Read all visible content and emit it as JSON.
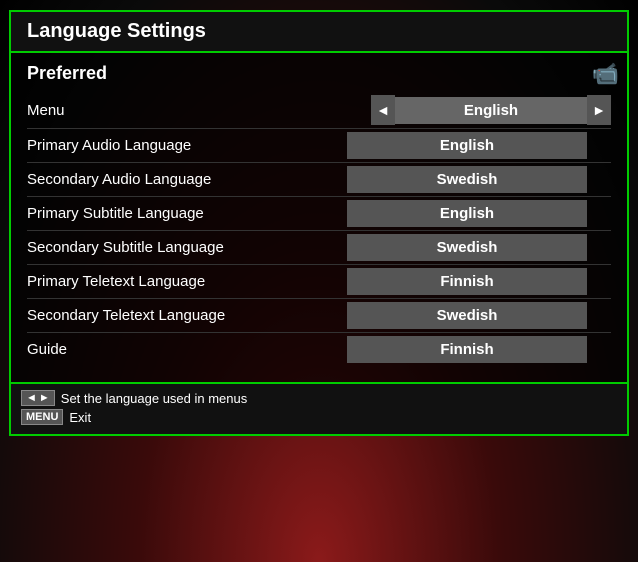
{
  "title": "Language Settings",
  "preferred_label": "Preferred",
  "rows": [
    {
      "id": "menu",
      "label": "Menu",
      "value": "English",
      "has_arrows": true
    },
    {
      "id": "primary-audio",
      "label": "Primary Audio Language",
      "value": "English",
      "has_arrows": false
    },
    {
      "id": "secondary-audio",
      "label": "Secondary Audio Language",
      "value": "Swedish",
      "has_arrows": false
    },
    {
      "id": "primary-subtitle",
      "label": "Primary Subtitle Language",
      "value": "English",
      "has_arrows": false
    },
    {
      "id": "secondary-subtitle",
      "label": "Secondary Subtitle Language",
      "value": "Swedish",
      "has_arrows": false
    },
    {
      "id": "primary-teletext",
      "label": "Primary Teletext Language",
      "value": "Finnish",
      "has_arrows": false
    },
    {
      "id": "secondary-teletext",
      "label": "Secondary Teletext Language",
      "value": "Swedish",
      "has_arrows": false
    },
    {
      "id": "guide",
      "label": "Guide",
      "value": "Finnish",
      "has_arrows": false
    }
  ],
  "footer": {
    "hint1": "Set the language used in menus",
    "hint2": "Exit"
  }
}
